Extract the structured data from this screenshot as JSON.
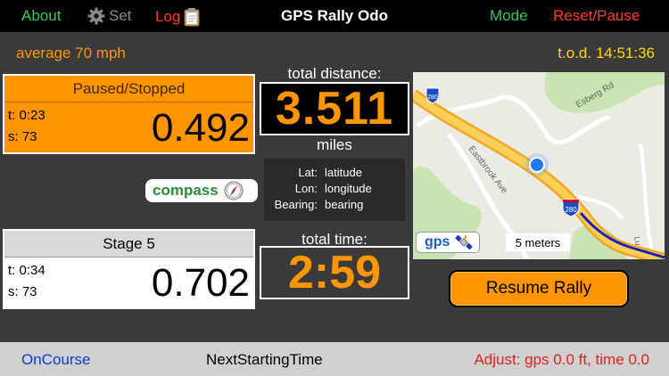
{
  "topbar": {
    "about": "About",
    "set": "Set",
    "log": "Log",
    "title": "GPS Rally Odo",
    "mode": "Mode",
    "reset": "Reset/Pause"
  },
  "header": {
    "average": "average 70 mph",
    "tod": "t.o.d. 14:51:36"
  },
  "paused_box": {
    "title": "Paused/Stopped",
    "t": "t: 0:23",
    "s": "s: 73",
    "value": "0.492"
  },
  "stage_box": {
    "title": "Stage 5",
    "t": "t: 0:34",
    "s": "s: 73",
    "value": "0.702"
  },
  "distance": {
    "label": "total distance:",
    "value": "3.511",
    "unit": "miles"
  },
  "coords": {
    "lat_label": "Lat:",
    "lat_value": "latitude",
    "lon_label": "Lon:",
    "lon_value": "longitude",
    "bearing_label": "Bearing:",
    "bearing_value": "bearing"
  },
  "compass": {
    "label": "compass",
    "icon": "compass-icon"
  },
  "time": {
    "label": "total time:",
    "value": "2:59"
  },
  "map": {
    "gps_label": "gps",
    "scale": "5 meters",
    "road_labels": [
      "Esberg Rd",
      "Eastbrook Ave",
      "280",
      "280",
      "Lu"
    ]
  },
  "resume_button": "Resume Rally",
  "bottombar": {
    "oncourse": "OnCourse",
    "next_starting_time": "NextStartingTime",
    "adjust": "Adjust: gps 0.0 ft, time 0.0"
  },
  "colors": {
    "orange": "#ff9500",
    "green": "#34c759",
    "red": "#ff3b30",
    "yellow": "#ffd60a",
    "blue": "#0a3fd6",
    "background": "#3a3a3a"
  }
}
